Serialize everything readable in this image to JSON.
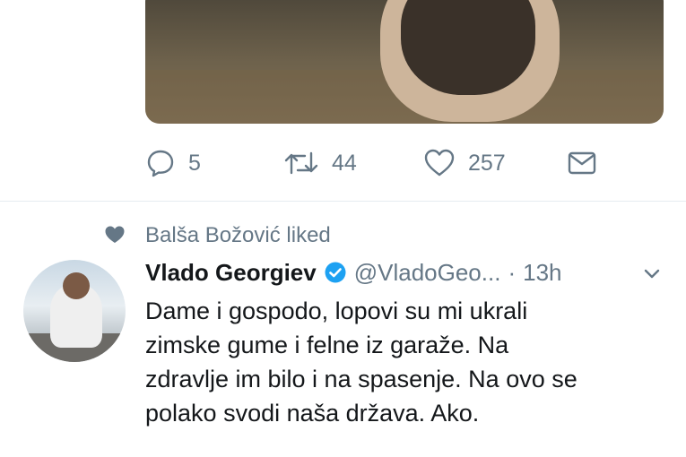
{
  "previous_tweet": {
    "media_alt": "pug photo",
    "actions": {
      "reply_count": "5",
      "retweet_count": "44",
      "like_count": "257"
    }
  },
  "tweet": {
    "context_label": "Balša Božović liked",
    "author_name": "Vlado Georgiev",
    "author_handle": "@VladoGeo...",
    "separator": "·",
    "time": "13h",
    "text_lines": [
      "Dame i gospodo, lopovi su mi ukrali",
      "zimske gume i felne iz garaže. Na",
      "zdravlje im bilo i na spasenje. Na ovo se",
      "polako svodi naša država. Ako."
    ]
  },
  "colors": {
    "secondary_text": "#657786",
    "primary_text": "#14171a",
    "verified_blue": "#1da1f2",
    "divider": "#e6ecf0"
  },
  "icons": [
    "reply-icon",
    "retweet-icon",
    "like-icon",
    "dm-icon",
    "heart-icon",
    "verified-icon",
    "chevron-down-icon"
  ]
}
